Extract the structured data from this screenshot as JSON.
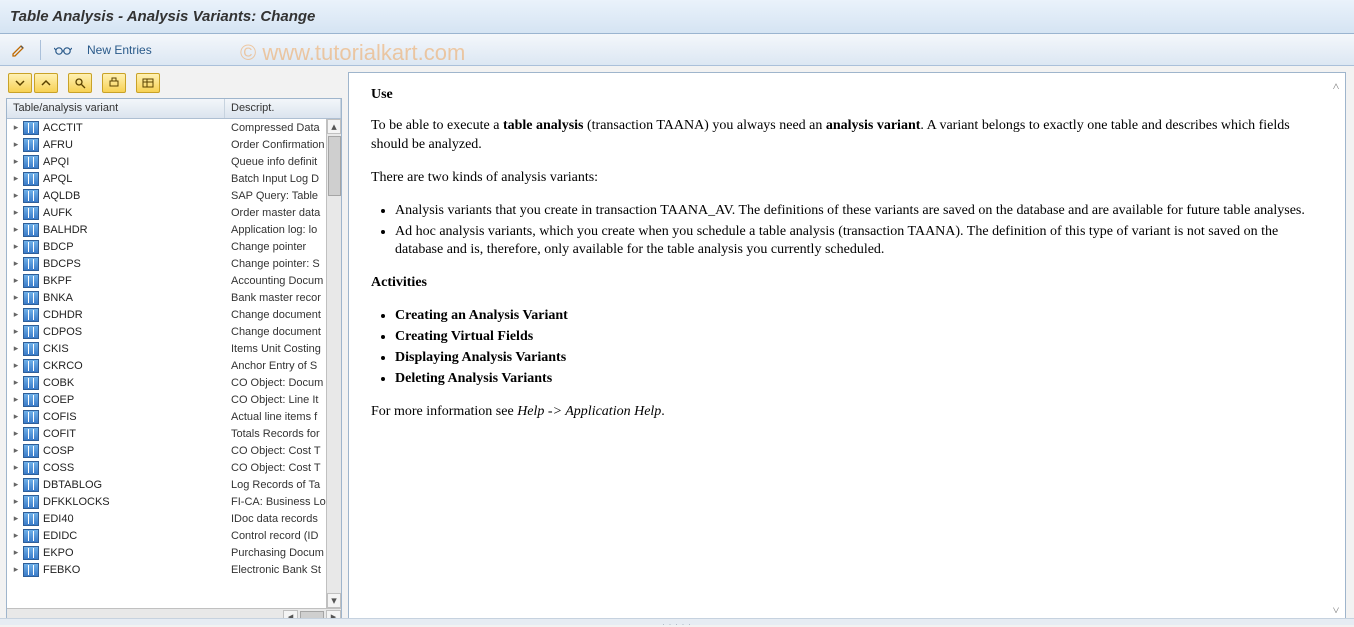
{
  "title": "Table Analysis - Analysis Variants: Change",
  "watermark": "© www.tutorialkart.com",
  "toolbar": {
    "new_entries": "New Entries"
  },
  "tree": {
    "header_name": "Table/analysis variant",
    "header_desc": "Descript.",
    "rows": [
      {
        "name": "ACCTIT",
        "desc": "Compressed Data"
      },
      {
        "name": "AFRU",
        "desc": "Order Confirmation"
      },
      {
        "name": "APQI",
        "desc": "Queue info definit"
      },
      {
        "name": "APQL",
        "desc": "Batch Input Log D"
      },
      {
        "name": "AQLDB",
        "desc": "SAP Query: Table"
      },
      {
        "name": "AUFK",
        "desc": "Order master data"
      },
      {
        "name": "BALHDR",
        "desc": "Application log: lo"
      },
      {
        "name": "BDCP",
        "desc": "Change pointer"
      },
      {
        "name": "BDCPS",
        "desc": "Change pointer: S"
      },
      {
        "name": "BKPF",
        "desc": "Accounting Docum"
      },
      {
        "name": "BNKA",
        "desc": "Bank master recor"
      },
      {
        "name": "CDHDR",
        "desc": "Change document"
      },
      {
        "name": "CDPOS",
        "desc": "Change document"
      },
      {
        "name": "CKIS",
        "desc": "Items Unit Costing"
      },
      {
        "name": "CKRCO",
        "desc": "Anchor Entry of S"
      },
      {
        "name": "COBK",
        "desc": "CO Object: Docum"
      },
      {
        "name": "COEP",
        "desc": "CO Object: Line It"
      },
      {
        "name": "COFIS",
        "desc": "Actual line items f"
      },
      {
        "name": "COFIT",
        "desc": "Totals Records for"
      },
      {
        "name": "COSP",
        "desc": "CO Object: Cost T"
      },
      {
        "name": "COSS",
        "desc": "CO Object: Cost T"
      },
      {
        "name": "DBTABLOG",
        "desc": "Log Records of Ta"
      },
      {
        "name": "DFKKLOCKS",
        "desc": "FI-CA: Business Lo"
      },
      {
        "name": "EDI40",
        "desc": "IDoc data records"
      },
      {
        "name": "EDIDC",
        "desc": "Control record (ID"
      },
      {
        "name": "EKPO",
        "desc": "Purchasing Docum"
      },
      {
        "name": "FEBKO",
        "desc": "Electronic Bank St"
      }
    ]
  },
  "help": {
    "h_use": "Use",
    "p_intro_a": "To be able to execute a ",
    "p_intro_b": "table analysis",
    "p_intro_c": " (transaction TAANA) you always need an ",
    "p_intro_d": "analysis variant",
    "p_intro_e": ". A variant belongs to exactly one table and describes which fields should be analyzed.",
    "p_kinds": "There are two kinds of analysis variants:",
    "li_kind1": "Analysis variants that you create in transaction TAANA_AV. The definitions of these variants are saved on the database and are available for future table analyses.",
    "li_kind2": "Ad hoc analysis variants, which you create when you schedule a table analysis (transaction TAANA). The definition of this type of variant is not saved on the database and is, therefore, only available for the table analysis you currently scheduled.",
    "h_activities": "Activities",
    "li_act1": "Creating an Analysis Variant",
    "li_act2": "Creating Virtual Fields",
    "li_act3": "Displaying Analysis Variants",
    "li_act4": "Deleting Analysis Variants",
    "p_more_a": "For more information see ",
    "p_more_b": "Help -> Application Help",
    "p_more_c": "."
  }
}
